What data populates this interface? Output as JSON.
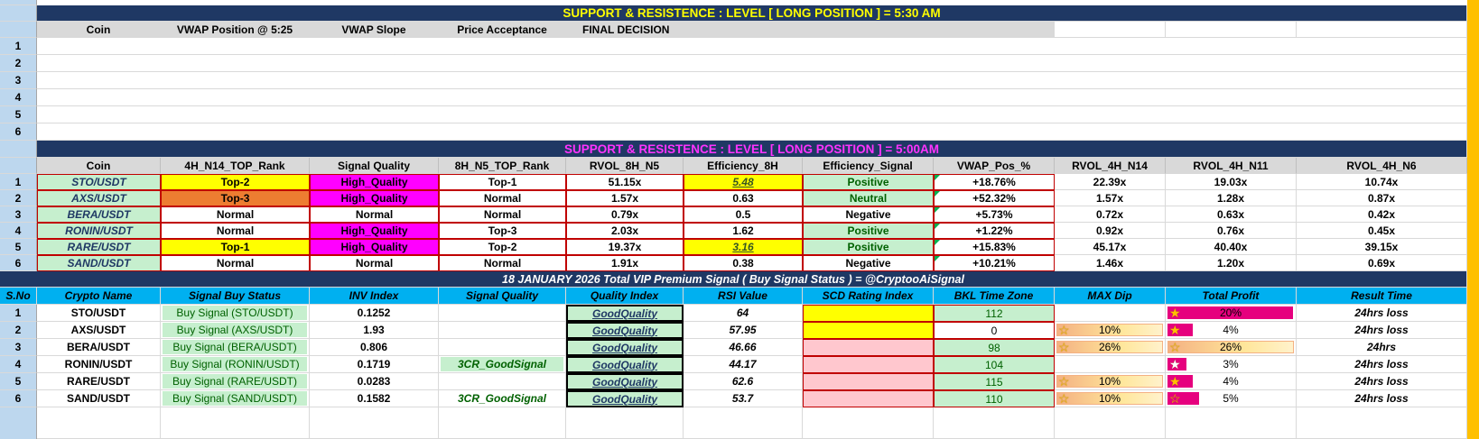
{
  "section1": {
    "banner": "SUPPORT  &  RESISTENCE : LEVEL    [  LONG  POSITION  ]       =       5:30 AM",
    "headers": [
      "Coin",
      "VWAP Position @ 5:25",
      "VWAP Slope",
      "Price Acceptance",
      "FINAL DECISION"
    ],
    "rows": [
      "1",
      "2",
      "3",
      "4",
      "5",
      "6"
    ]
  },
  "section2": {
    "banner": "SUPPORT  &  RESISTENCE : LEVEL    [  LONG  POSITION  ]       =       5:00AM",
    "headers": [
      "Coin",
      "4H_N14_TOP_Rank",
      "Signal Quality",
      "8H_N5_TOP_Rank",
      "RVOL_8H_N5",
      "Efficiency_8H",
      "Efficiency_Signal",
      "VWAP_Pos_%",
      "RVOL_4H_N14",
      "RVOL_4H_N11",
      "RVOL_4H_N6"
    ],
    "rows": [
      {
        "n": "1",
        "coin": "STO/USDT",
        "rank4h": "Top-2",
        "quality": "High_Quality",
        "rank8h": "Top-1",
        "rvol8h": "51.15x",
        "eff": "5.48",
        "effsig": "Positive",
        "vwap": "+18.76%",
        "r14": "22.39x",
        "r11": "19.03x",
        "r6": "10.74x"
      },
      {
        "n": "2",
        "coin": "AXS/USDT",
        "rank4h": "Top-3",
        "quality": "High_Quality",
        "rank8h": "Normal",
        "rvol8h": "1.57x",
        "eff": "0.63",
        "effsig": "Neutral",
        "vwap": "+52.32%",
        "r14": "1.57x",
        "r11": "1.28x",
        "r6": "0.87x"
      },
      {
        "n": "3",
        "coin": "BERA/USDT",
        "rank4h": "Normal",
        "quality": "Normal",
        "rank8h": "Normal",
        "rvol8h": "0.79x",
        "eff": "0.5",
        "effsig": "Negative",
        "vwap": "+5.73%",
        "r14": "0.72x",
        "r11": "0.63x",
        "r6": "0.42x"
      },
      {
        "n": "4",
        "coin": "RONIN/USDT",
        "rank4h": "Normal",
        "quality": "High_Quality",
        "rank8h": "Top-3",
        "rvol8h": "2.03x",
        "eff": "1.62",
        "effsig": "Positive",
        "vwap": "+1.22%",
        "r14": "0.92x",
        "r11": "0.76x",
        "r6": "0.45x"
      },
      {
        "n": "5",
        "coin": "RARE/USDT",
        "rank4h": "Top-1",
        "quality": "High_Quality",
        "rank8h": "Top-2",
        "rvol8h": "19.37x",
        "eff": "3.16",
        "effsig": "Positive",
        "vwap": "+15.83%",
        "r14": "45.17x",
        "r11": "40.40x",
        "r6": "39.15x"
      },
      {
        "n": "6",
        "coin": "SAND/USDT",
        "rank4h": "Normal",
        "quality": "Normal",
        "rank8h": "Normal",
        "rvol8h": "1.91x",
        "eff": "0.38",
        "effsig": "Negative",
        "vwap": "+10.21%",
        "r14": "1.46x",
        "r11": "1.20x",
        "r6": "0.69x"
      }
    ]
  },
  "section3": {
    "banner": "18  JANUARY   2026   Total VIP Premium Signal  ( Buy Signal Status )    =   @CryptooAiSignal",
    "headers": [
      "S.No",
      "Crypto Name",
      "Signal Buy Status",
      "INV  Index",
      "Signal Quality",
      "Quality Index",
      "RSI Value",
      "SCD  Rating Index",
      "BKL Time Zone",
      "MAX Dip",
      "Total Profit",
      "Result Time"
    ],
    "rows": [
      {
        "n": "1",
        "name": "STO/USDT",
        "status": "Buy Signal (STO/USDT)",
        "inv": "0.1252",
        "sq": "",
        "qi": "GoodQuality",
        "rsi": "64",
        "bkl": "112",
        "md": "",
        "tp": "20%",
        "tp_value": 20,
        "rt": "24hrs loss"
      },
      {
        "n": "2",
        "name": "AXS/USDT",
        "status": "Buy Signal (AXS/USDT)",
        "inv": "1.93",
        "sq": "",
        "qi": "GoodQuality",
        "rsi": "57.95",
        "bkl": "0",
        "md": "10%",
        "tp": "4%",
        "tp_value": 4,
        "rt": "24hrs loss"
      },
      {
        "n": "3",
        "name": "BERA/USDT",
        "status": "Buy Signal (BERA/USDT)",
        "inv": "0.806",
        "sq": "",
        "qi": "GoodQuality",
        "rsi": "46.66",
        "bkl": "98",
        "md": "26%",
        "tp": "26%",
        "tp_value": 26,
        "rt": "24hrs"
      },
      {
        "n": "4",
        "name": "RONIN/USDT",
        "status": "Buy Signal (RONIN/USDT)",
        "inv": "0.1719",
        "sq": "3CR_GoodSignal",
        "qi": "GoodQuality",
        "rsi": "44.17",
        "bkl": "104",
        "md": "",
        "tp": "3%",
        "tp_value": 3,
        "rt": "24hrs loss"
      },
      {
        "n": "5",
        "name": "RARE/USDT",
        "status": "Buy Signal (RARE/USDT)",
        "inv": "0.0283",
        "sq": "",
        "qi": "GoodQuality",
        "rsi": "62.6",
        "bkl": "115",
        "md": "10%",
        "tp": "4%",
        "tp_value": 4,
        "rt": "24hrs loss"
      },
      {
        "n": "6",
        "name": "SAND/USDT",
        "status": "Buy Signal (SAND/USDT)",
        "inv": "0.1582",
        "sq": "3CR_GoodSignal",
        "qi": "GoodQuality",
        "rsi": "53.7",
        "bkl": "110",
        "md": "10%",
        "tp": "5%",
        "tp_value": 5,
        "rt": "24hrs loss"
      }
    ]
  },
  "colors": {
    "banner_bg": "#1F3864",
    "banner_text_yellow": "#FFFF00",
    "banner_text_magenta": "#FF33FF",
    "header_cyan": "#00B0F0",
    "positive_green": "#C6EFCE",
    "high_quality_magenta": "#FF00FF",
    "total_profit_pink": "#E6007E",
    "max_dip_gold": "#F4B183",
    "page_border": "#FFC000"
  }
}
